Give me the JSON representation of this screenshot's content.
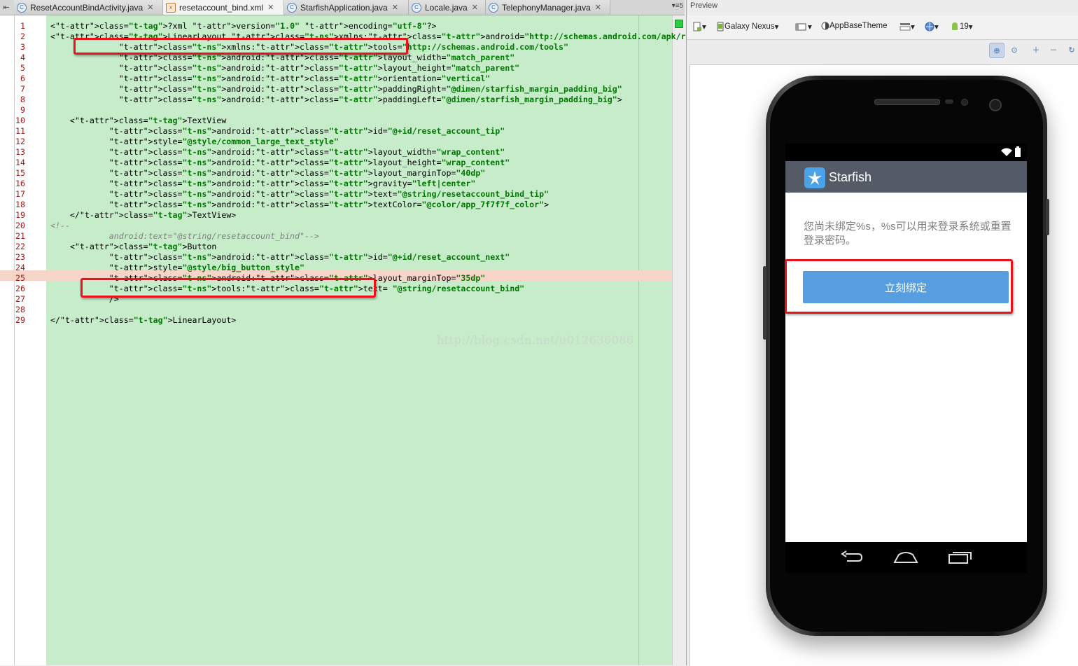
{
  "tabs": [
    {
      "label": "ResetAccountBindActivity.java",
      "type": "java",
      "active": false
    },
    {
      "label": "resetaccount_bind.xml",
      "type": "xml",
      "active": true
    },
    {
      "label": "StarfishApplication.java",
      "type": "java",
      "active": false
    },
    {
      "label": "Locale.java",
      "type": "java",
      "active": false
    },
    {
      "label": "TelephonyManager.java",
      "type": "java",
      "active": false
    }
  ],
  "tab_overflow_label": "5",
  "editor": {
    "error_line": 25,
    "lines": [
      "<?xml version=\"1.0\" encoding=\"utf-8\"?>",
      "<LinearLayout xmlns:android=\"http://schemas.android.com/apk/res/android\"",
      "              xmlns:tools=\"http://schemas.android.com/tools\"",
      "              android:layout_width=\"match_parent\"",
      "              android:layout_height=\"match_parent\"",
      "              android:orientation=\"vertical\"",
      "              android:paddingRight=\"@dimen/starfish_margin_padding_big\"",
      "              android:paddingLeft=\"@dimen/starfish_margin_padding_big\">",
      "",
      "    <TextView",
      "            android:id=\"@+id/reset_account_tip\"",
      "            style=\"@style/common_large_text_style\"",
      "            android:layout_width=\"wrap_content\"",
      "            android:layout_height=\"wrap_content\"",
      "            android:layout_marginTop=\"40dp\"",
      "            android:gravity=\"left|center\"",
      "            android:text=\"@string/resetaccount_bind_tip\"",
      "            android:textColor=\"@color/app_7f7f7f_color\">",
      "    </TextView>",
      "<!--",
      "            android:text=\"@string/resetaccount_bind\"-->",
      "    <Button",
      "            android:id=\"@+id/reset_account_next\"",
      "            style=\"@style/big_button_style\"",
      "            android:layout_marginTop=\"35dp\"",
      "            tools:text= \"@string/resetaccount_bind\"",
      "            />",
      "",
      "</LinearLayout>"
    ],
    "watermark": "http://blog.csdn.net/u012636086"
  },
  "preview": {
    "title": "Preview",
    "device": "Galaxy Nexus",
    "theme": "AppBaseTheme",
    "api_level": "19",
    "app_name": "Starfish",
    "tip_text": "您尚未绑定%s，%s可以用来登录系统或重置登录密码。",
    "button_text": "立刻绑定"
  },
  "colors": {
    "editor_bg": "#c6ecca",
    "error_line": "#f7d4c8",
    "highlight_box": "#e8121a",
    "action_bar": "#545b67",
    "button": "#569ee0"
  }
}
